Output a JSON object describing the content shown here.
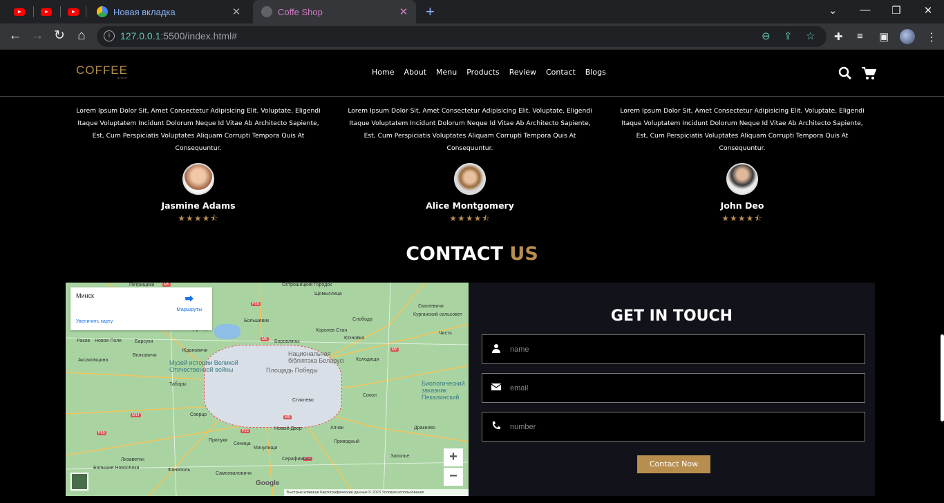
{
  "browser": {
    "tabs": [
      {
        "title": "Новая вкладка",
        "active": false
      },
      {
        "title": "Coffe Shop",
        "active": true
      }
    ],
    "url_host": "127.0.0.1",
    "url_rest": ":5500/index.html#"
  },
  "site": {
    "logo": "COFFEE",
    "logo_sub": "SHOP",
    "nav": [
      "Home",
      "About",
      "Menu",
      "Products",
      "Review",
      "Contact",
      "Blogs"
    ],
    "reviews": [
      {
        "text": "Lorem Ipsum Dolor Sit, Amet Consectetur Adipisicing Elit. Voluptate, Eligendi Itaque Voluptatem Incidunt Dolorum Neque Id Vitae Ab Architecto Sapiente, Est, Cum Perspiciatis Voluptates Aliquam Corrupti Tempora Quis At Consequuntur.",
        "name": "Jasmine Adams",
        "rating": 4.5
      },
      {
        "text": "Lorem Ipsum Dolor Sit, Amet Consectetur Adipisicing Elit. Voluptate, Eligendi Itaque Voluptatem Incidunt Dolorum Neque Id Vitae Ab Architecto Sapiente, Est, Cum Perspiciatis Voluptates Aliquam Corrupti Tempora Quis At Consequuntur.",
        "name": "Alice Montgomery",
        "rating": 4.5
      },
      {
        "text": "Lorem Ipsum Dolor Sit, Amet Consectetur Adipisicing Elit. Voluptate, Eligendi Itaque Voluptatem Incidunt Dolorum Neque Id Vitae Ab Architecto Sapiente, Est, Cum Perspiciatis Voluptates Aliquam Corrupti Tempora Quis At Consequuntur.",
        "name": "John Deo",
        "rating": 4.5
      }
    ],
    "contact_title_1": "CONTACT",
    "contact_title_2": "US",
    "map": {
      "place": "Минск",
      "directions": "Маршруты",
      "enlarge": "Увеличить карту",
      "google": "Google",
      "attribution": "Быстрые клавиши    Картографические данные © 2023    Условия использования",
      "labels": [
        "Петрищики",
        "Острошицкий Городок",
        "Большевик",
        "Боровляны",
        "Королев Стан",
        "Слобода",
        "Смолевичи",
        "Ждановичи",
        "Новый Двор",
        "Сеница",
        "Озерцо",
        "Прилуки",
        "Мачулищи",
        "Самохваловичи",
        "Фаниполь",
        "Лизаветин",
        "Серафимово",
        "Колодищи",
        "Сокол",
        "Дрозды",
        "Юхновка",
        "Курганский сельсовет",
        "Приводный",
        "Апчак",
        "Волковичи",
        "Барсуки",
        "Таборы",
        "Раков",
        "Новое Поле",
        "Аксаковщина",
        "Заполье",
        "Дракново",
        "Чисть",
        "Щомыслица",
        "Большие Новосёлки",
        "Стиклево"
      ],
      "museum": "Музей истории Великой Отечественной войны",
      "library": "Национальная бібліятэка Беларусі",
      "square": "Площадь Победы",
      "reserve": "Биологический заказник Пекалинский"
    },
    "form": {
      "title": "GET IN TOUCH",
      "name_ph": "name",
      "email_ph": "email",
      "number_ph": "number",
      "button": "Contact Now"
    }
  },
  "colors": {
    "accent": "#b88e4f",
    "form_bg": "#12131a"
  }
}
